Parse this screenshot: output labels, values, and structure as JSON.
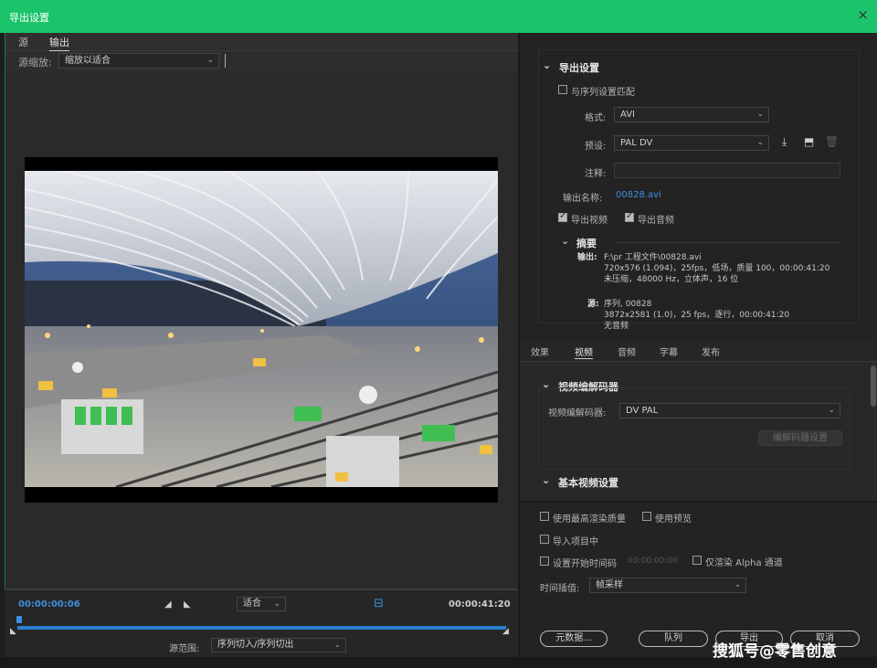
{
  "window": {
    "title": "导出设置",
    "close_icon": "×"
  },
  "source_panel": {
    "tabs": [
      "源",
      "输出"
    ],
    "active_tab": "输出",
    "scale_label": "源缩放:",
    "scale_value": "缩放以适合"
  },
  "timeline": {
    "current_time": "00:00:00:06",
    "end_time": "00:00:41:20",
    "fit_value": "适合",
    "range_label": "源范围:",
    "range_value": "序列切入/序列切出",
    "playhead_fraction": 0.003
  },
  "export_settings": {
    "section_title": "导出设置",
    "match_sequence_label": "与序列设置匹配",
    "match_sequence_checked": false,
    "format_label": "格式:",
    "format_value": "AVI",
    "preset_label": "预设:",
    "preset_value": "PAL DV",
    "comment_label": "注释:",
    "comment_value": "",
    "output_name_label": "输出名称:",
    "output_name_value": "00828.avi",
    "export_video_label": "导出视频",
    "export_video_checked": true,
    "export_audio_label": "导出音频",
    "export_audio_checked": true,
    "summary_title": "摘要",
    "output_label": "输出:",
    "output_lines": [
      "F:\\pr 工程文件\\00828.avi",
      "720x576 (1.094)，25fps，低场，质量 100，00:00:41:20",
      "未压缩，48000 Hz，立体声，16 位"
    ],
    "source_label": "源:",
    "source_lines": [
      "序列, 00828",
      "3872x2581 (1.0)，25 fps，逐行，00:00:41:20",
      "无音频"
    ]
  },
  "settings_tabs": [
    "效果",
    "视频",
    "音频",
    "字幕",
    "发布"
  ],
  "active_settings_tab": "视频",
  "codec": {
    "section_title": "视频编解码器",
    "codec_label": "视频编解码器:",
    "codec_value": "DV PAL",
    "codec_settings_button": "编解码器设置",
    "basic_section_title": "基本视频设置"
  },
  "render_options": {
    "max_quality_label": "使用最高渲染质量",
    "use_previews_label": "使用预览",
    "import_project_label": "导入项目中",
    "set_start_tc_label": "设置开始时间码",
    "start_tc_value": "00:00:00:00",
    "alpha_only_label": "仅渲染 Alpha 通道",
    "interpolation_label": "时间插值:",
    "interpolation_value": "帧采样"
  },
  "buttons": {
    "metadata": "元数据...",
    "queue": "队列",
    "export": "导出",
    "cancel": "取消"
  },
  "watermark": "搜狐号@零售创意",
  "colors": {
    "title_bar": "#1bc46a",
    "accent_blue": "#3d8fe0",
    "timeline_track": "#2b7fd2"
  }
}
